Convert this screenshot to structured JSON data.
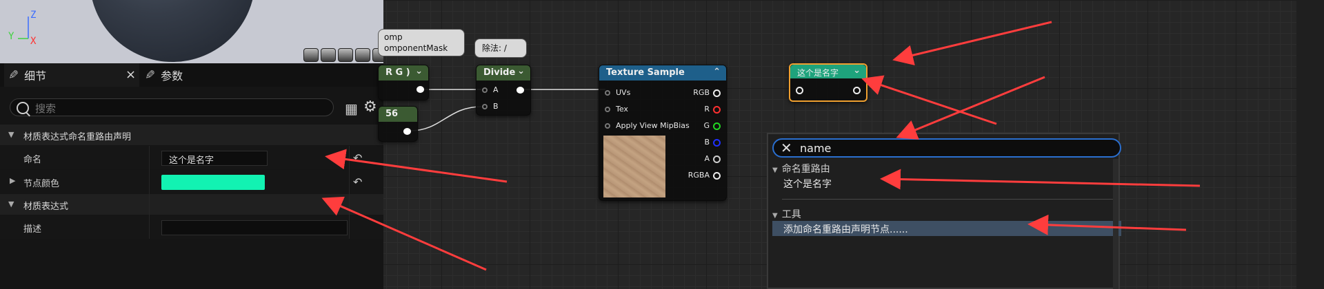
{
  "viewport": {
    "axes": {
      "z": "Z",
      "y": "Y",
      "x": "X"
    }
  },
  "details": {
    "tabs": [
      {
        "label": "细节",
        "close": "×"
      },
      {
        "label": "参数"
      }
    ],
    "search": {
      "placeholder": "搜索"
    },
    "categories": [
      {
        "label": "材质表达式命名重路由声明",
        "rows": [
          {
            "label": "命名",
            "value": "这个是名字"
          },
          {
            "label": "节点颜色",
            "color": "#12f2b2"
          }
        ]
      },
      {
        "label": "材质表达式",
        "rows": [
          {
            "label": "描述",
            "value": ""
          }
        ]
      }
    ]
  },
  "graph": {
    "comments": {
      "comp_line1": "omp",
      "comp_line2": "omponentMask",
      "divide_comment": "除法: /"
    },
    "nodes": {
      "mask": {
        "title": "R G )"
      },
      "constant": {
        "title": "56"
      },
      "divide": {
        "title": "Divide",
        "pins": [
          "A",
          "B"
        ]
      },
      "texture_sample": {
        "title": "Texture Sample",
        "inputs": [
          "UVs",
          "Tex",
          "Apply View MipBias"
        ],
        "outputs": [
          "RGB",
          "R",
          "G",
          "B",
          "A",
          "RGBA"
        ]
      },
      "named_reroute": {
        "title": "这个是名字",
        "color": "#1ea37c"
      }
    }
  },
  "popup": {
    "query": "name",
    "sections": [
      {
        "label": "命名重路由",
        "items": [
          "这个是名字"
        ]
      },
      {
        "label": "工具",
        "items": [
          "添加命名重路由声明节点......"
        ]
      }
    ]
  },
  "colors": {
    "accent_arrow": "#ff3d3d",
    "selection": "#f0a030",
    "texture_header": "#1e5f8a"
  }
}
